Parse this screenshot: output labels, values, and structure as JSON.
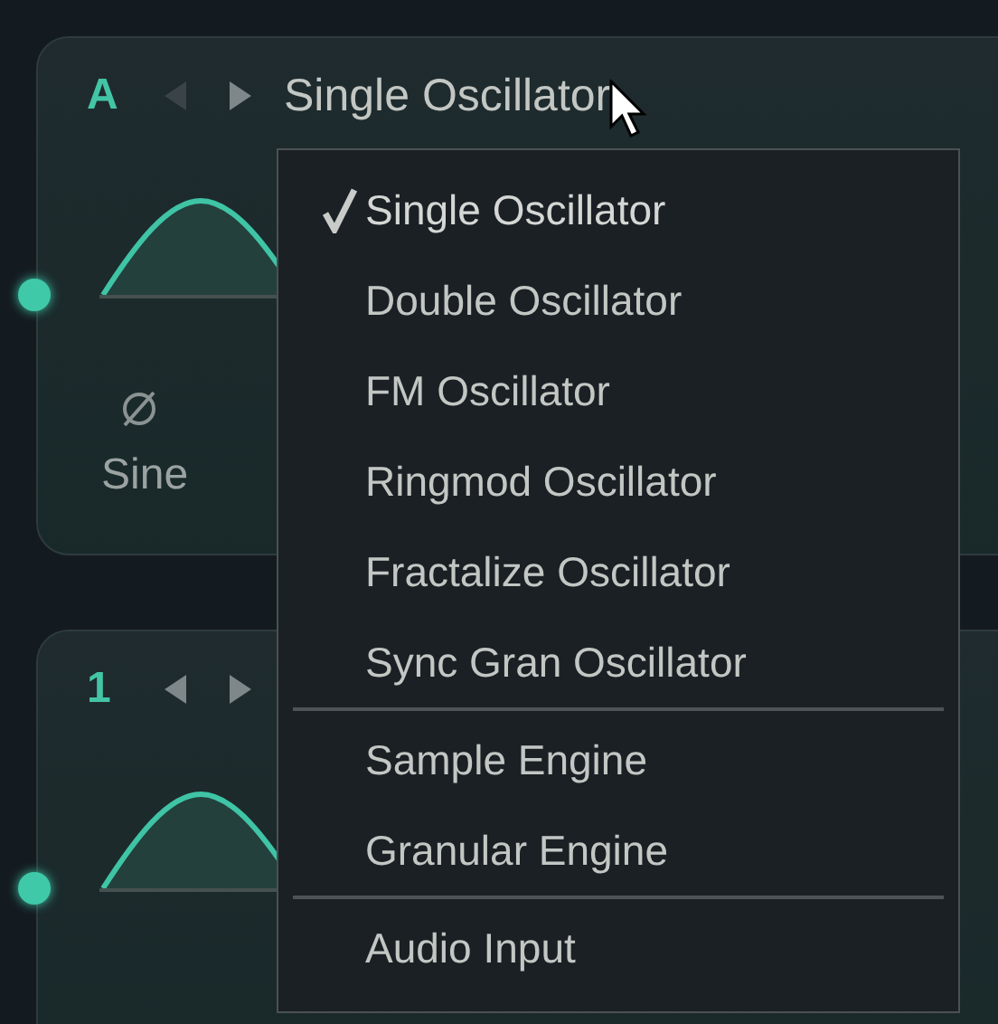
{
  "panels": [
    {
      "label": "A",
      "title": "Single Oscillator",
      "waveform": "Sine"
    },
    {
      "label": "1"
    }
  ],
  "menu": {
    "groups": [
      [
        {
          "label": "Single Oscillator",
          "selected": true
        },
        {
          "label": "Double Oscillator",
          "selected": false
        },
        {
          "label": "FM Oscillator",
          "selected": false
        },
        {
          "label": "Ringmod Oscillator",
          "selected": false
        },
        {
          "label": "Fractalize Oscillator",
          "selected": false
        },
        {
          "label": "Sync Gran Oscillator",
          "selected": false
        }
      ],
      [
        {
          "label": "Sample Engine",
          "selected": false
        },
        {
          "label": "Granular Engine",
          "selected": false
        }
      ],
      [
        {
          "label": "Audio Input",
          "selected": false
        }
      ]
    ]
  }
}
